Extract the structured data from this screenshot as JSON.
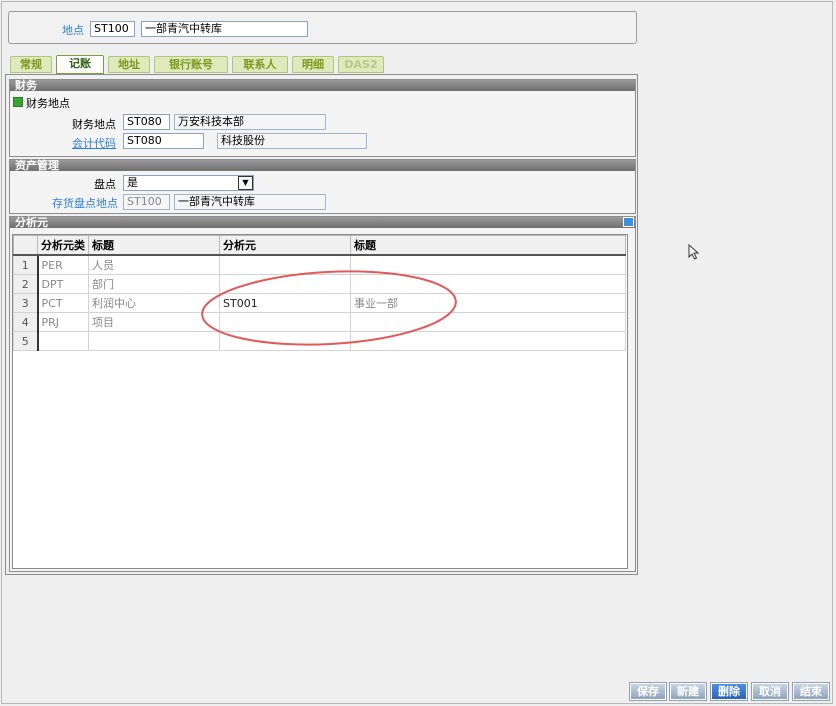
{
  "header": {
    "site_label": "地点",
    "site_code": "ST100",
    "site_name": "一部青汽中转库"
  },
  "tabs": [
    {
      "label": "常规"
    },
    {
      "label": "记账"
    },
    {
      "label": "地址"
    },
    {
      "label": "银行账号"
    },
    {
      "label": "联系人"
    },
    {
      "label": "明细"
    },
    {
      "label": "DAS2"
    }
  ],
  "finance": {
    "title": "财务",
    "checkbox_label": "财务地点",
    "finance_site_label": "财务地点",
    "finance_site_code": "ST080",
    "finance_site_name": "万安科技本部",
    "account_code_label": "会计代码",
    "account_code": "ST080",
    "account_name": "科技股份"
  },
  "asset": {
    "title": "资产管理",
    "inventory_label": "盘点",
    "inventory_value": "是",
    "inventory_site_label": "存货盘点地点",
    "inventory_site_code": "ST100",
    "inventory_site_name": "一部青汽中转库"
  },
  "analysis": {
    "title": "分析元",
    "columns": [
      "分析元类",
      "标题",
      "分析元",
      "标题"
    ],
    "rows": [
      {
        "num": "1",
        "type": "PER",
        "title": "人员",
        "element": "",
        "element_title": ""
      },
      {
        "num": "2",
        "type": "DPT",
        "title": "部门",
        "element": "",
        "element_title": ""
      },
      {
        "num": "3",
        "type": "PCT",
        "title": "利润中心",
        "element": "ST001",
        "element_title": "事业一部"
      },
      {
        "num": "4",
        "type": "PRJ",
        "title": "项目",
        "element": "",
        "element_title": ""
      },
      {
        "num": "5",
        "type": "",
        "title": "",
        "element": "",
        "element_title": ""
      }
    ]
  },
  "buttons": {
    "save": "保存",
    "new": "新建",
    "delete": "删除",
    "cancel": "取消",
    "finish": "结束"
  },
  "colors": {
    "link_blue": "#2f7fd7",
    "tab_green": "#7d9a20",
    "annotation_red": "#e05a5a"
  }
}
